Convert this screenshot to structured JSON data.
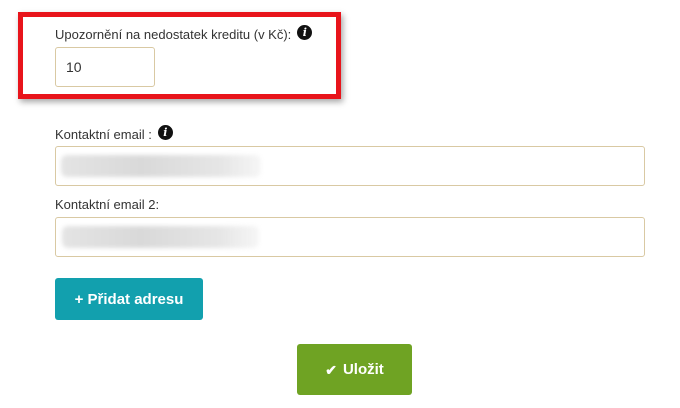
{
  "credit_warning": {
    "label": "Upozornění na nedostatek kreditu (v Kč):",
    "info_icon": "info-icon",
    "value": "10"
  },
  "contact_email": {
    "label": "Kontaktní email :",
    "info_icon": "info-icon",
    "value": ""
  },
  "contact_email_2": {
    "label": "Kontaktní email 2:",
    "value": ""
  },
  "add_address_button": {
    "label": "+ Přidat adresu"
  },
  "save_button": {
    "icon": "check-icon",
    "label": "Uložit"
  },
  "colors": {
    "highlight": "#e8141b",
    "add_button": "#12a0ae",
    "save_button": "#6fa323",
    "input_border": "#d9c9a3"
  }
}
